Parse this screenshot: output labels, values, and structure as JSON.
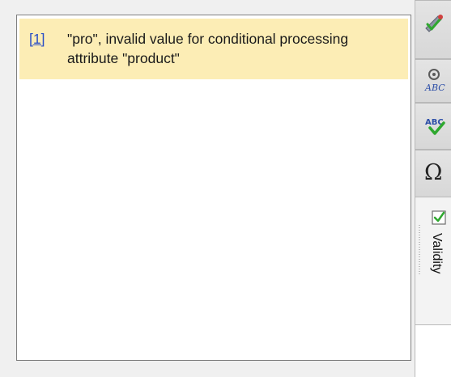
{
  "messages": [
    {
      "link": "[1]",
      "text": "\"pro\", invalid value for conditional processing attribute \"product\""
    }
  ],
  "toolbar": {
    "buttons": [
      {
        "name": "validate-icon"
      },
      {
        "name": "spell-check-options-icon"
      },
      {
        "name": "spell-check-icon"
      },
      {
        "name": "special-characters-icon",
        "glyph": "Ω"
      }
    ]
  },
  "tabs": {
    "validity_label": "Validity"
  },
  "colors": {
    "message_bg": "#fcedb5",
    "link": "#2a4fc6",
    "check_green": "#2fa82f"
  }
}
